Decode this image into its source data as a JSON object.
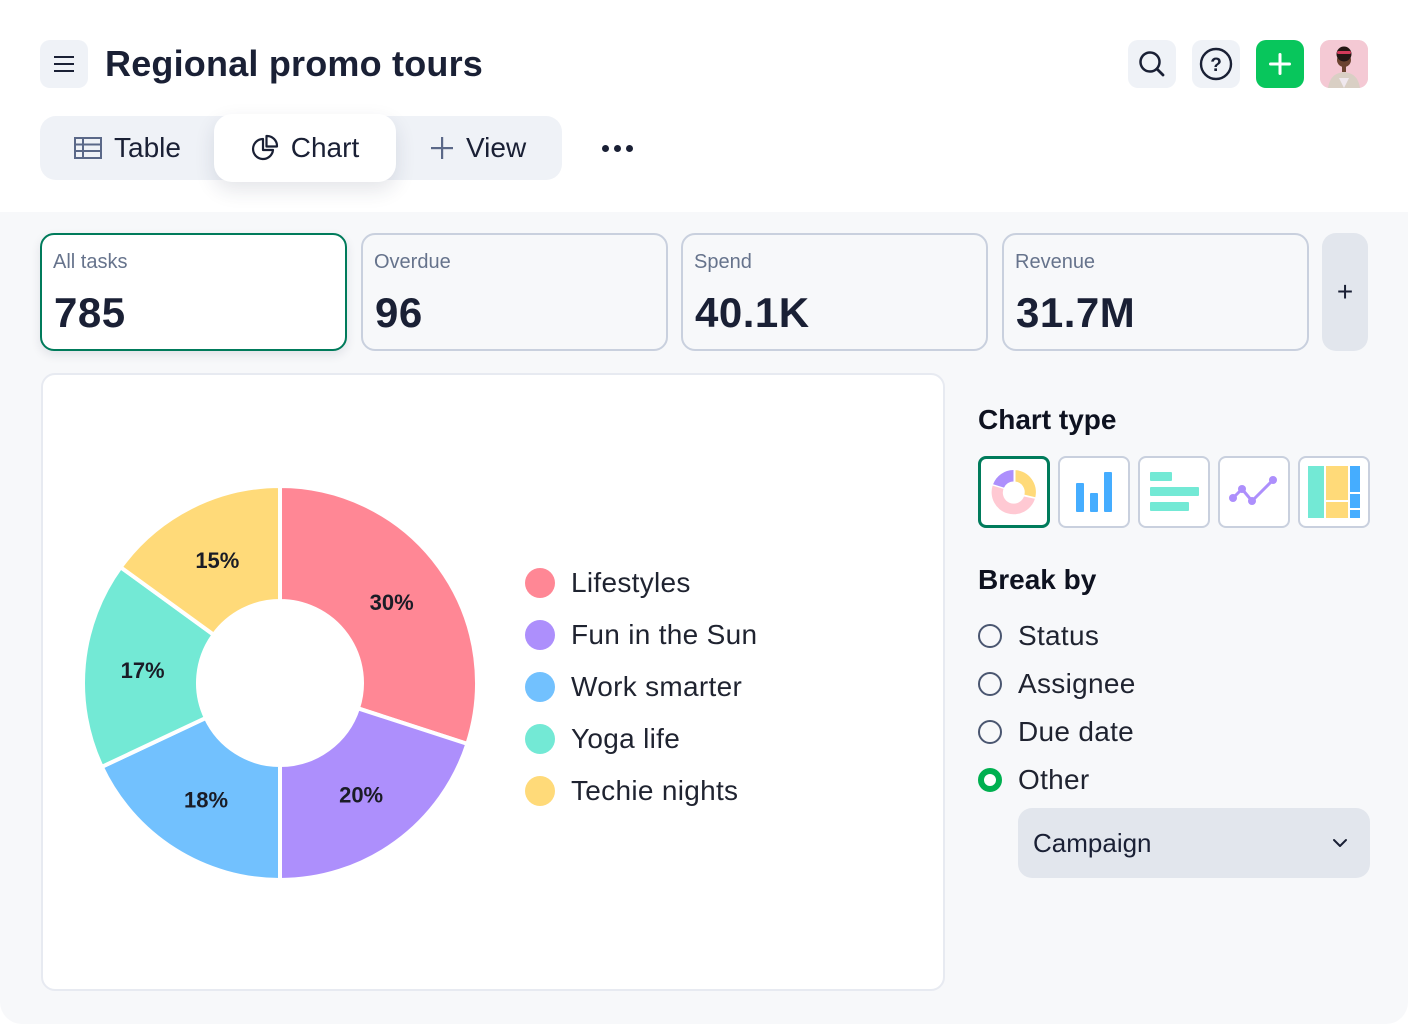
{
  "header": {
    "title": "Regional promo tours",
    "icons": {
      "menu": "hamburger-icon",
      "search": "search-icon",
      "help": "help-icon",
      "add": "plus-icon",
      "avatar": "user-avatar"
    }
  },
  "tabs": [
    {
      "label": "Table",
      "icon": "table-icon",
      "active": false
    },
    {
      "label": "Chart",
      "icon": "pie-chart-icon",
      "active": true
    },
    {
      "label": "View",
      "icon": "plus-icon",
      "active": false
    }
  ],
  "more_icon": "more-horizontal-icon",
  "cards": [
    {
      "label": "All tasks",
      "value": "785",
      "active": true
    },
    {
      "label": "Overdue",
      "value": "96",
      "active": false
    },
    {
      "label": "Spend",
      "value": "40.1K",
      "active": false
    },
    {
      "label": "Revenue",
      "value": "31.7M",
      "active": false
    }
  ],
  "add_card_label": "+",
  "chart_data": {
    "type": "pie",
    "variant": "donut",
    "categories": [
      "Lifestyles",
      "Fun in the Sun",
      "Work smarter",
      "Yoga life",
      "Techie nights"
    ],
    "values": [
      30,
      20,
      18,
      17,
      15
    ],
    "labels": [
      "30%",
      "20%",
      "18%",
      "17%",
      "15%"
    ],
    "colors": [
      "#ff8795",
      "#ad8ffc",
      "#72c1fe",
      "#73e9d5",
      "#ffda79"
    ],
    "unit": "%",
    "legend_position": "right",
    "start_angle": "12 o'clock",
    "direction": "clockwise"
  },
  "sidebar": {
    "chart_type_heading": "Chart type",
    "chart_types": [
      {
        "name": "donut",
        "icon": "donut-chart-icon",
        "active": true
      },
      {
        "name": "column",
        "icon": "bar-chart-icon",
        "active": false
      },
      {
        "name": "bar",
        "icon": "horizontal-bar-chart-icon",
        "active": false
      },
      {
        "name": "line",
        "icon": "line-chart-icon",
        "active": false
      },
      {
        "name": "treemap",
        "icon": "treemap-icon",
        "active": false
      }
    ],
    "break_by_heading": "Break by",
    "break_by_options": [
      {
        "label": "Status",
        "checked": false
      },
      {
        "label": "Assignee",
        "checked": false
      },
      {
        "label": "Due date",
        "checked": false
      },
      {
        "label": "Other",
        "checked": true
      }
    ],
    "other_select_value": "Campaign"
  },
  "colors": {
    "accent_green": "#08c65c",
    "active_border": "#007b5b",
    "radio_checked": "#00b050",
    "text_dark": "#1a2035"
  }
}
